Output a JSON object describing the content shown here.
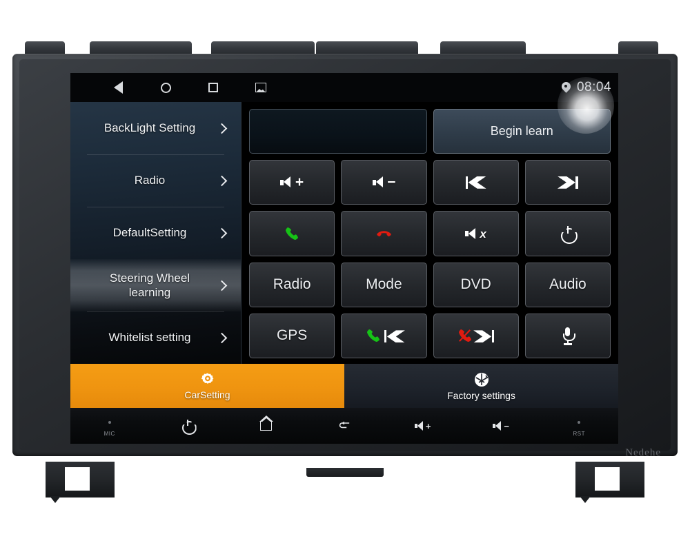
{
  "device": {
    "brand_watermark": "Nedehe"
  },
  "statusbar": {
    "nav": [
      {
        "name": "back",
        "icon": "triangle-back-icon"
      },
      {
        "name": "home",
        "icon": "circle-home-icon"
      },
      {
        "name": "recents",
        "icon": "square-recents-icon"
      },
      {
        "name": "screenshot",
        "icon": "image-icon"
      }
    ],
    "location_icon": "location-pin-icon",
    "clock": "08:04"
  },
  "sidebar": {
    "items": [
      {
        "label": "BackLight Setting",
        "selected": false
      },
      {
        "label": "Radio",
        "selected": false
      },
      {
        "label": "DefaultSetting",
        "selected": false
      },
      {
        "label": "Steering Wheel learning",
        "selected": true
      },
      {
        "label": "Whitelist setting",
        "selected": false
      }
    ]
  },
  "panel": {
    "display_field_value": "",
    "begin_learn_label": "Begin learn",
    "rows": [
      [
        {
          "label": "",
          "icon": "volume-up-icon"
        },
        {
          "label": "",
          "icon": "volume-down-icon"
        },
        {
          "label": "",
          "icon": "previous-track-icon"
        },
        {
          "label": "",
          "icon": "next-track-icon"
        }
      ],
      [
        {
          "label": "",
          "icon": "answer-call-icon"
        },
        {
          "label": "",
          "icon": "end-call-icon"
        },
        {
          "label": "",
          "icon": "mute-icon"
        },
        {
          "label": "",
          "icon": "power-icon"
        }
      ],
      [
        {
          "label": "Radio",
          "icon": ""
        },
        {
          "label": "Mode",
          "icon": ""
        },
        {
          "label": "DVD",
          "icon": ""
        },
        {
          "label": "Audio",
          "icon": ""
        }
      ],
      [
        {
          "label": "GPS",
          "icon": ""
        },
        {
          "label": "",
          "icon": "call-previous-icon"
        },
        {
          "label": "",
          "icon": "callend-next-icon"
        },
        {
          "label": "",
          "icon": "microphone-icon"
        }
      ]
    ]
  },
  "tabs": [
    {
      "label": "CarSetting",
      "icon": "gear-icon",
      "active": true
    },
    {
      "label": "Factory settings",
      "icon": "factory-reset-icon",
      "active": false
    }
  ],
  "hardware_keys": [
    {
      "label": "MIC",
      "icon": "mic-dot-icon"
    },
    {
      "label": "",
      "icon": "power-icon"
    },
    {
      "label": "",
      "icon": "home-icon"
    },
    {
      "label": "",
      "icon": "back-icon"
    },
    {
      "label": "",
      "icon": "volume-up-icon"
    },
    {
      "label": "",
      "icon": "volume-down-icon"
    },
    {
      "label": "RST",
      "icon": "reset-dot-icon"
    }
  ],
  "colors": {
    "accent_orange": "#f09311",
    "call_green": "#16c216",
    "call_red": "#e01b10",
    "screen_black": "#000000"
  }
}
